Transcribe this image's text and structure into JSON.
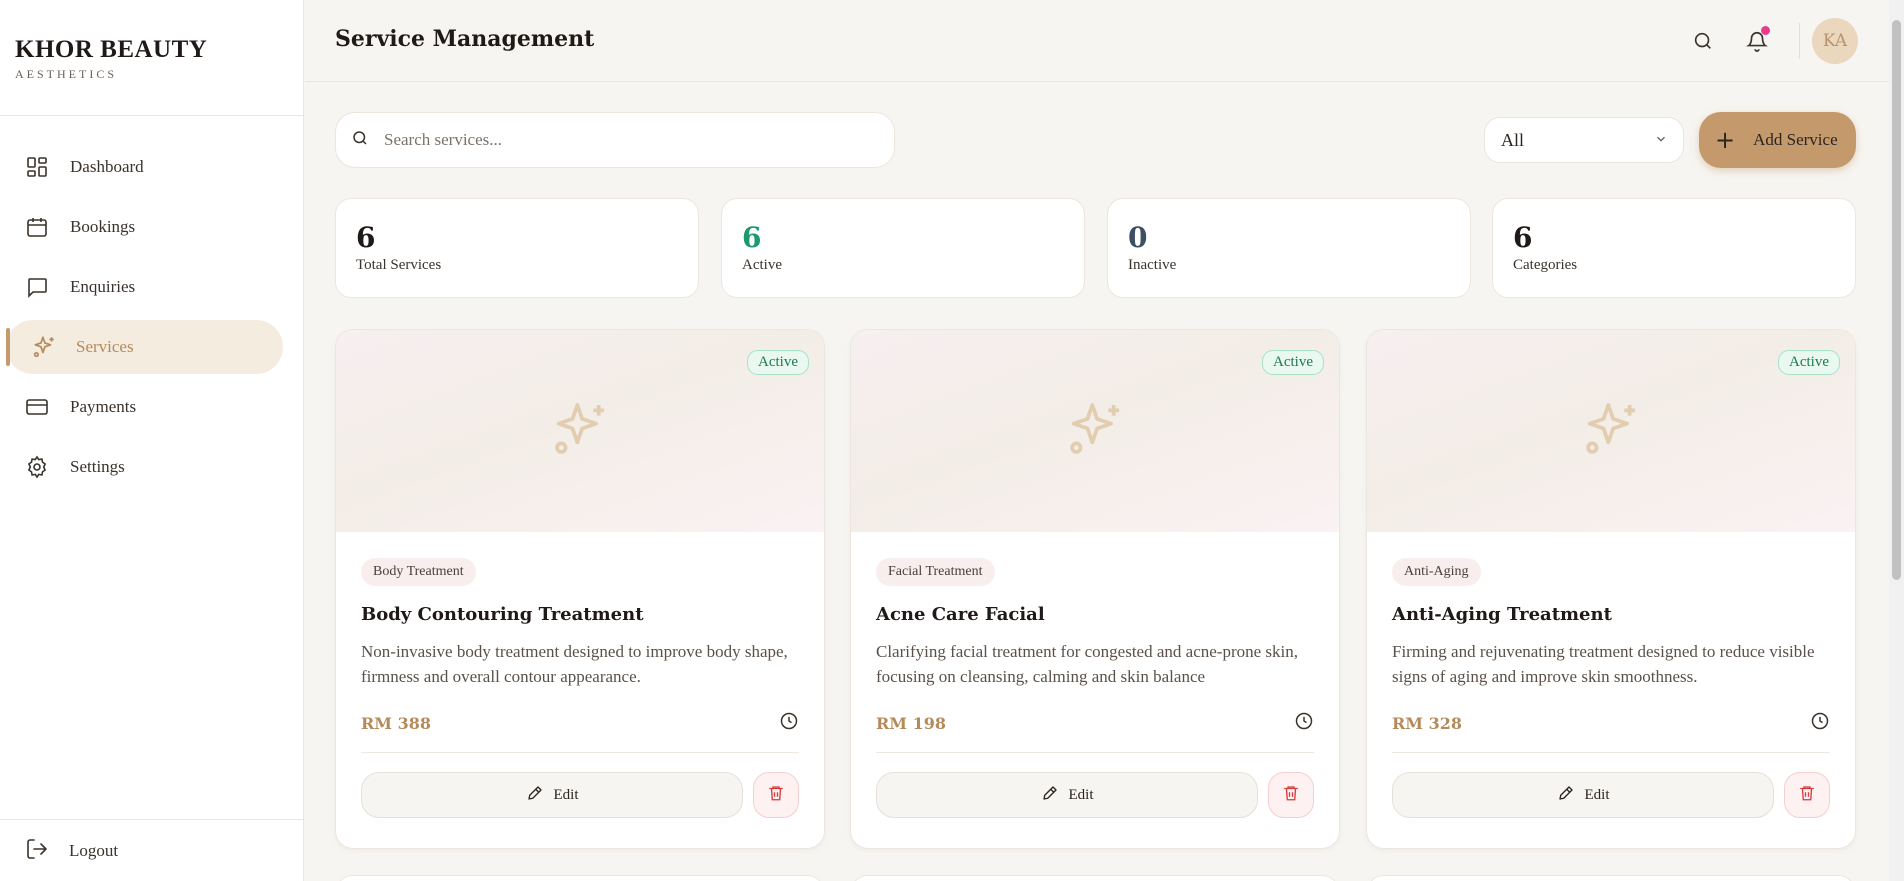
{
  "brand": {
    "name": "KHOR BEAUTY",
    "subtitle": "AESTHETICS"
  },
  "sidebar": {
    "items": [
      {
        "label": "Dashboard",
        "icon": "grid-icon"
      },
      {
        "label": "Bookings",
        "icon": "calendar-icon"
      },
      {
        "label": "Enquiries",
        "icon": "message-icon"
      },
      {
        "label": "Services",
        "icon": "sparkles-icon",
        "active": true
      },
      {
        "label": "Payments",
        "icon": "credit-card-icon"
      },
      {
        "label": "Settings",
        "icon": "gear-icon"
      }
    ],
    "logout": "Logout"
  },
  "header": {
    "title": "Service Management",
    "avatar_initials": "KA"
  },
  "toolbar": {
    "search_placeholder": "Search services...",
    "filter_value": "All",
    "add_label": "Add Service"
  },
  "stats": [
    {
      "value": "6",
      "label": "Total Services",
      "color": "#1f1a17"
    },
    {
      "value": "6",
      "label": "Active",
      "color": "#1d9a6c"
    },
    {
      "value": "0",
      "label": "Inactive",
      "color": "#3d4f63"
    },
    {
      "value": "6",
      "label": "Categories",
      "color": "#1f1a17"
    }
  ],
  "services": [
    {
      "status": "Active",
      "category": "Body Treatment",
      "title": "Body Contouring Treatment",
      "description": "Non-invasive body treatment designed to improve body shape, firmness and overall contour appearance.",
      "price": "RM 388",
      "edit_label": "Edit"
    },
    {
      "status": "Active",
      "category": "Facial Treatment",
      "title": "Acne Care Facial",
      "description": "Clarifying facial treatment for congested and acne-prone skin, focusing on cleansing, calming and skin balance",
      "price": "RM 198",
      "edit_label": "Edit"
    },
    {
      "status": "Active",
      "category": "Anti-Aging",
      "title": "Anti-Aging Treatment",
      "description": "Firming and rejuvenating treatment designed to reduce visible signs of aging and improve skin smoothness.",
      "price": "RM 328",
      "edit_label": "Edit"
    }
  ],
  "colors": {
    "accent": "#c49a6c",
    "active_green": "#1d7a53",
    "danger": "#d63a3a"
  }
}
